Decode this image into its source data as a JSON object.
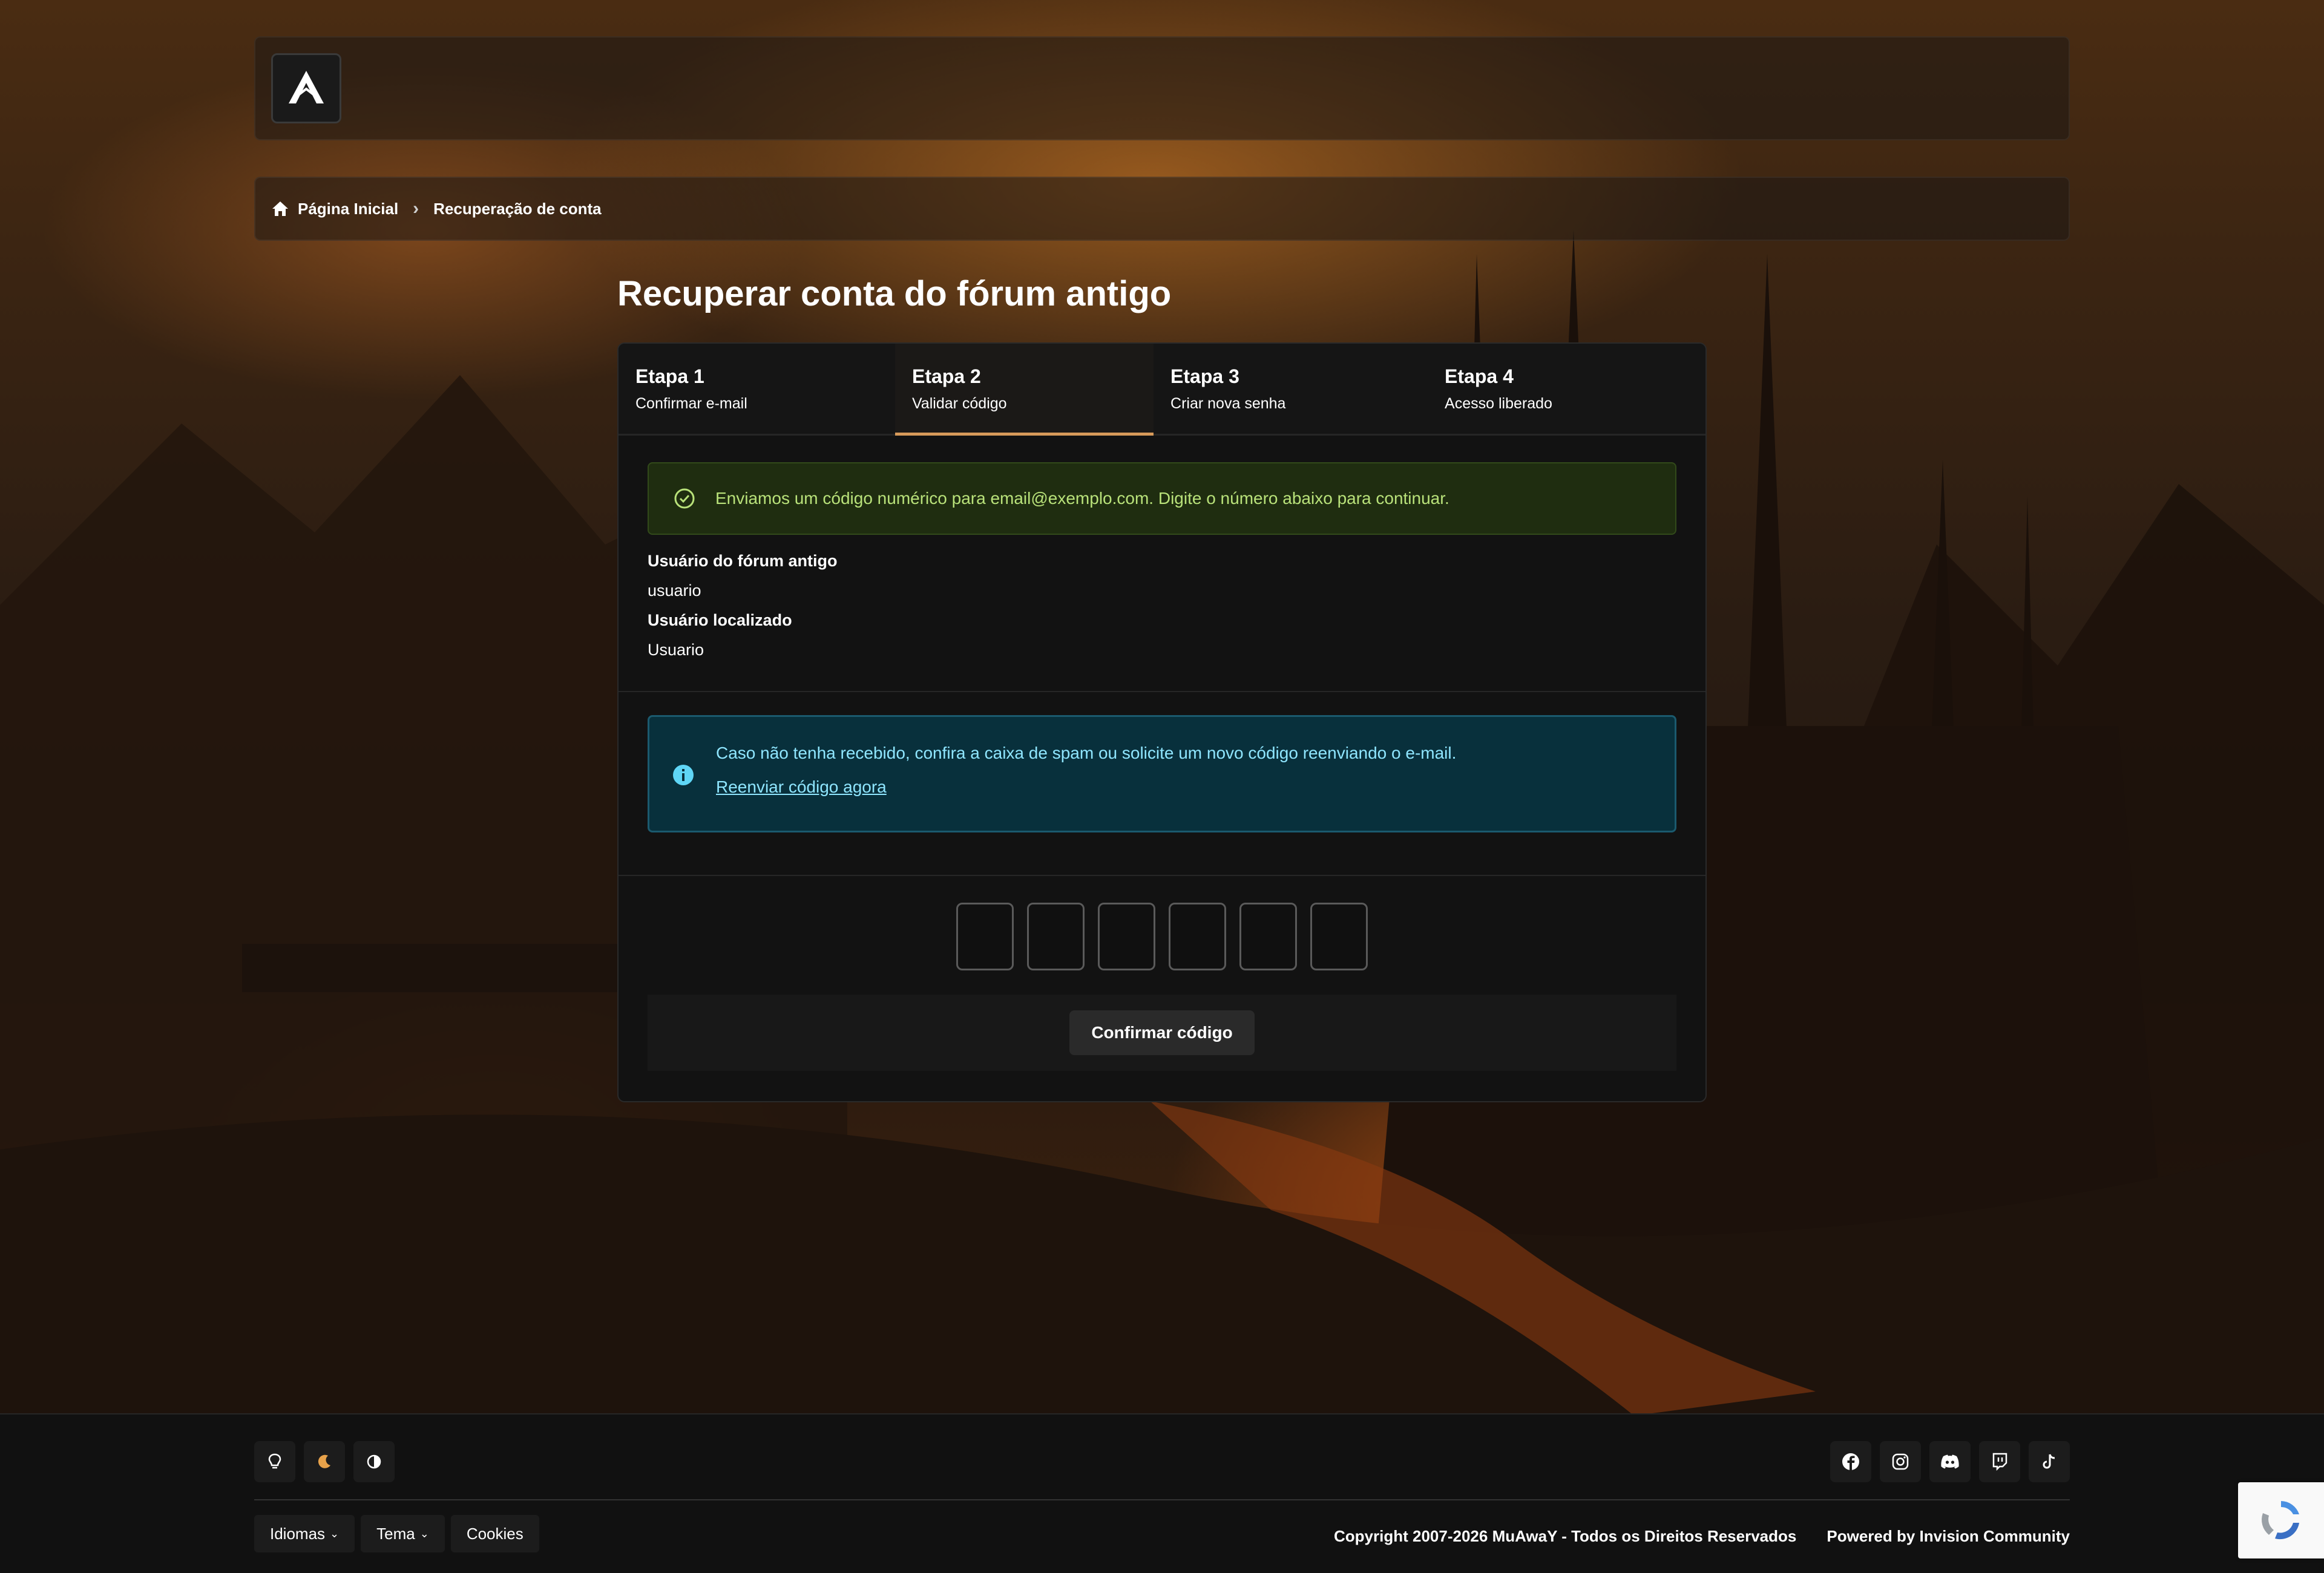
{
  "breadcrumb": {
    "home": "Página Inicial",
    "current": "Recuperação de conta"
  },
  "page": {
    "title": "Recuperar conta do fórum antigo"
  },
  "steps": [
    {
      "title": "Etapa 1",
      "subtitle": "Confirmar e-mail",
      "active": false
    },
    {
      "title": "Etapa 2",
      "subtitle": "Validar código",
      "active": true
    },
    {
      "title": "Etapa 3",
      "subtitle": "Criar nova senha",
      "active": false
    },
    {
      "title": "Etapa 4",
      "subtitle": "Acesso liberado",
      "active": false
    }
  ],
  "success_alert": {
    "text": "Enviamos um código numérico para email@exemplo.com. Digite o número abaixo para continuar."
  },
  "user_info": {
    "old_user_label": "Usuário do fórum antigo",
    "old_user_value": "usuario",
    "found_user_label": "Usuário localizado",
    "found_user_value": "Usuario"
  },
  "info_alert": {
    "text": "Caso não tenha recebido, confira a caixa de spam ou solicite um novo código reenviando o e-mail.",
    "link": "Reenviar código agora"
  },
  "code_inputs": {
    "count": 6,
    "values": [
      "",
      "",
      "",
      "",
      "",
      ""
    ]
  },
  "actions": {
    "confirm_label": "Confirmar código"
  },
  "footer": {
    "languages": "Idiomas",
    "theme": "Tema",
    "cookies": "Cookies",
    "copyright": "Copyright 2007-2026 MuAwaY - Todos os Direitos Reservados",
    "powered": "Powered by Invision Community",
    "theme_icons": [
      "lightbulb-icon",
      "moon-icon",
      "contrast-icon"
    ],
    "social_icons": [
      "facebook-icon",
      "instagram-icon",
      "discord-icon",
      "twitch-icon",
      "tiktok-icon"
    ]
  },
  "colors": {
    "accent": "#d79a5a",
    "success_text": "#b9e27a",
    "info_text": "#8fe6ff"
  }
}
